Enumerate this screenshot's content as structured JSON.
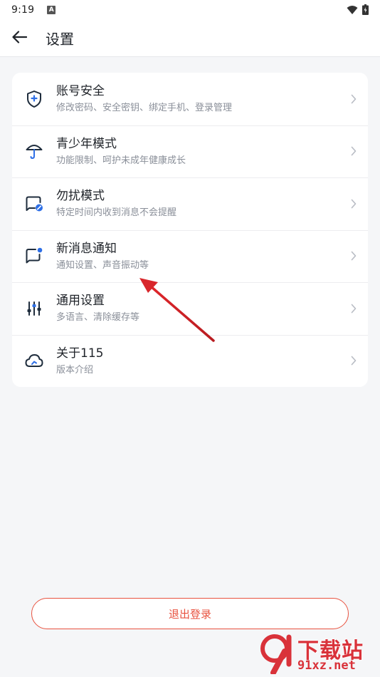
{
  "status_bar": {
    "time": "9:19",
    "notification_badge": "A"
  },
  "header": {
    "title": "设置"
  },
  "settings": [
    {
      "title": "账号安全",
      "subtitle": "修改密码、安全密钥、绑定手机、登录管理",
      "icon": "shield-plus-icon"
    },
    {
      "title": "青少年模式",
      "subtitle": "功能限制、呵护未成年健康成长",
      "icon": "umbrella-icon"
    },
    {
      "title": "勿扰模式",
      "subtitle": "特定时间内收到消息不会提醒",
      "icon": "do-not-disturb-icon"
    },
    {
      "title": "新消息通知",
      "subtitle": "通知设置、声音振动等",
      "icon": "message-dot-icon"
    },
    {
      "title": "通用设置",
      "subtitle": "多语言、清除缓存等",
      "icon": "sliders-icon"
    },
    {
      "title": "关于115",
      "subtitle": "版本介绍",
      "icon": "cloud-icon"
    }
  ],
  "logout": {
    "label": "退出登录"
  },
  "watermark": {
    "title": "下载站",
    "url": "91xz.net"
  },
  "colors": {
    "accent": "#2e6fe6",
    "icon_dark": "#1f2d3d",
    "danger": "#e8523f",
    "arrow": "#d8262b"
  }
}
